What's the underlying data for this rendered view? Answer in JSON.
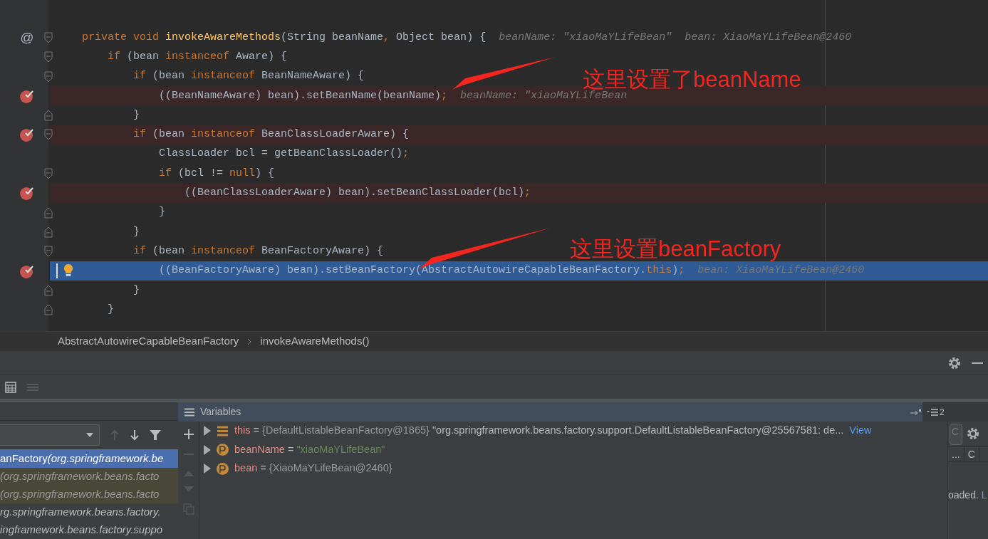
{
  "editor": {
    "lines": [
      {
        "gutter": "@",
        "breakpoint": false,
        "current": false,
        "tokens": [
          {
            "kind": "kw",
            "t": "private void "
          },
          {
            "kind": "fn",
            "t": "invokeAwareMethods"
          },
          {
            "kind": "plain",
            "t": "(String beanName"
          },
          {
            "kind": "kw",
            "t": ", "
          },
          {
            "kind": "plain",
            "t": "Object bean) {"
          }
        ],
        "hint": "beanName: \"xiaoMaYLifeBean\"  bean: XiaoMaYLifeBean@2460",
        "children": [
          {
            "breakpoint": false,
            "current": false,
            "tokens": [
              {
                "kind": "kw",
                "t": "if "
              },
              {
                "kind": "plain",
                "t": "(bean "
              },
              {
                "kind": "kw",
                "t": "instanceof "
              },
              {
                "kind": "plain",
                "t": "Aware) {"
              }
            ],
            "children": [
              {
                "breakpoint": false,
                "current": false,
                "tokens": [
                  {
                    "kind": "kw",
                    "t": "if "
                  },
                  {
                    "kind": "plain",
                    "t": "(bean "
                  },
                  {
                    "kind": "kw",
                    "t": "instanceof "
                  },
                  {
                    "kind": "plain",
                    "t": "BeanNameAware) {"
                  }
                ],
                "children": [
                  {
                    "breakpoint": true,
                    "current": false,
                    "tokens": [
                      {
                        "kind": "plain",
                        "t": "((BeanNameAware) bean).setBeanName(beanName)"
                      },
                      {
                        "kind": "kw",
                        "t": ";"
                      }
                    ],
                    "hint": "beanName: \"xiaoMaYLifeBean"
                  }
                ]
              },
              {
                "closing": true,
                "breakpoint": false,
                "current": false,
                "tokens": [
                  {
                    "kind": "plain",
                    "t": "}"
                  }
                ]
              },
              {
                "breakpoint": true,
                "current": false,
                "tokens": [
                  {
                    "kind": "kw",
                    "t": "if "
                  },
                  {
                    "kind": "plain",
                    "t": "(bean "
                  },
                  {
                    "kind": "kw",
                    "t": "instanceof "
                  },
                  {
                    "kind": "plain",
                    "t": "BeanClassLoaderAware) {"
                  }
                ],
                "children": [
                  {
                    "breakpoint": false,
                    "current": false,
                    "tokens": [
                      {
                        "kind": "plain",
                        "t": "ClassLoader bcl = getBeanClassLoader()"
                      },
                      {
                        "kind": "kw",
                        "t": ";"
                      }
                    ]
                  },
                  {
                    "breakpoint": false,
                    "current": false,
                    "tokens": [
                      {
                        "kind": "kw",
                        "t": "if "
                      },
                      {
                        "kind": "plain",
                        "t": "(bcl != "
                      },
                      {
                        "kind": "kw",
                        "t": "null"
                      },
                      {
                        "kind": "plain",
                        "t": ") {"
                      }
                    ],
                    "children": [
                      {
                        "breakpoint": true,
                        "current": false,
                        "tokens": [
                          {
                            "kind": "plain",
                            "t": "((BeanClassLoaderAware) bean).setBeanClassLoader(bcl)"
                          },
                          {
                            "kind": "kw",
                            "t": ";"
                          }
                        ]
                      }
                    ]
                  },
                  {
                    "closing": true,
                    "breakpoint": false,
                    "current": false,
                    "tokens": [
                      {
                        "kind": "plain",
                        "t": "}"
                      }
                    ]
                  }
                ]
              },
              {
                "closing": true,
                "breakpoint": false,
                "current": false,
                "tokens": [
                  {
                    "kind": "plain",
                    "t": "}"
                  }
                ]
              },
              {
                "breakpoint": false,
                "current": false,
                "tokens": [
                  {
                    "kind": "kw",
                    "t": "if "
                  },
                  {
                    "kind": "plain",
                    "t": "(bean "
                  },
                  {
                    "kind": "kw",
                    "t": "instanceof "
                  },
                  {
                    "kind": "plain",
                    "t": "BeanFactoryAware) {"
                  }
                ],
                "children": [
                  {
                    "breakpoint": true,
                    "current": true,
                    "tokens": [
                      {
                        "kind": "plain",
                        "t": "((BeanFactoryAware) bean).setBeanFactory(AbstractAutowireCapableBeanFactory."
                      },
                      {
                        "kind": "kw",
                        "t": "this"
                      },
                      {
                        "kind": "plain",
                        "t": ")"
                      },
                      {
                        "kind": "kw",
                        "t": ";"
                      }
                    ],
                    "hint": "bean: XiaoMaYLifeBean@2460"
                  }
                ]
              },
              {
                "closing": true,
                "breakpoint": false,
                "current": false,
                "tokens": [
                  {
                    "kind": "plain",
                    "t": "}"
                  }
                ]
              }
            ]
          },
          {
            "closing": true,
            "breakpoint": false,
            "current": false,
            "tokens": [
              {
                "kind": "plain",
                "t": "}"
              }
            ]
          }
        ]
      }
    ],
    "annotations": [
      {
        "text": "这里设置了beanName"
      },
      {
        "text": "这里设置beanFactory"
      }
    ]
  },
  "breadcrumb": [
    "AbstractAutowireCapableBeanFactory",
    "invokeAwareMethods()"
  ],
  "frames": [
    {
      "method": "anFactory",
      "location": "(org.springframework.be",
      "selected": true,
      "library": false
    },
    {
      "location": "(org.springframework.beans.facto",
      "selected": false,
      "library": true
    },
    {
      "location": "(org.springframework.beans.facto",
      "selected": false,
      "library": true
    },
    {
      "location": "rg.springframework.beans.factory.",
      "selected": false,
      "library": false
    },
    {
      "location": "ingframework.beans.factory.suppo",
      "selected": false,
      "library": false
    }
  ],
  "variables": {
    "title": "Variables",
    "threads": "2",
    "rows": [
      {
        "kind": "field",
        "name": "this",
        "op": "=",
        "ref": "{DefaultListableBeanFactory@1865}",
        "value": "\"org.springframework.beans.factory.support.DefaultListableBeanFactory@25567581: de...",
        "link": "View"
      },
      {
        "kind": "param",
        "name": "beanName",
        "op": "=",
        "value": "\"xiaoMaYLifeBean\""
      },
      {
        "kind": "param",
        "name": "bean",
        "op": "=",
        "ref": "{XiaoMaYLifeBean@2460}"
      }
    ]
  },
  "side_panel": {
    "field": "C",
    "columns": [
      "...",
      "C"
    ],
    "status": "oaded.",
    "status_link": "L"
  }
}
